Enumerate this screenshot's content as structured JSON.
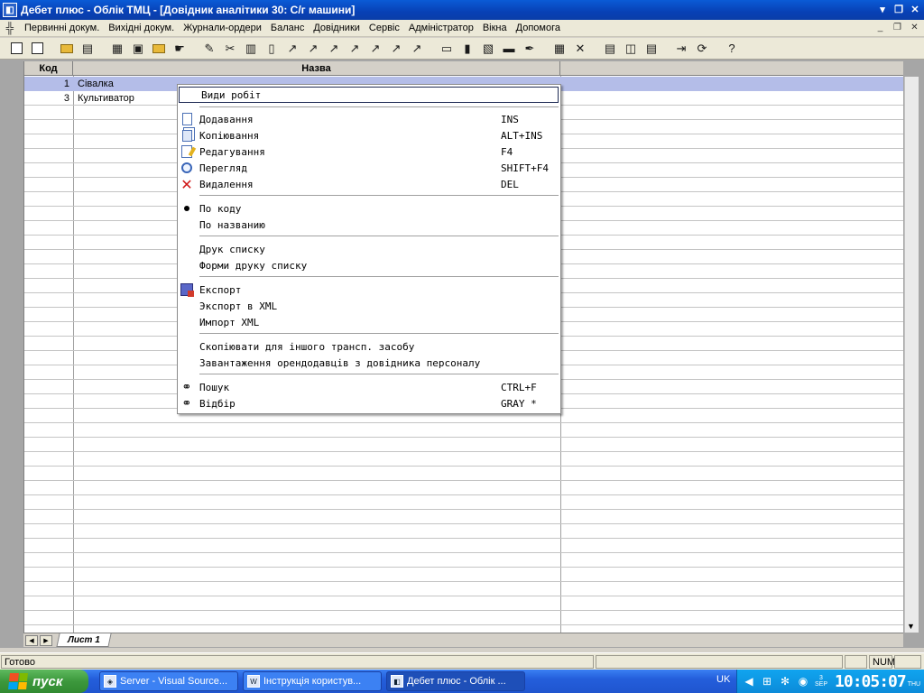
{
  "window": {
    "title": "Дебет плюс - Облік ТМЦ - [Довідник аналітики 30: С/г машини]"
  },
  "menubar": {
    "items": [
      "Первинні докум.",
      "Вихідні докум.",
      "Журнали-ордери",
      "Баланс",
      "Довідники",
      "Сервіс",
      "Адміністратор",
      "Вікна",
      "Допомога"
    ]
  },
  "grid": {
    "columns": [
      "Код",
      "Назва"
    ],
    "rows": [
      {
        "code": "1",
        "name": "Сівалка"
      },
      {
        "code": "3",
        "name": "Культиватор"
      }
    ]
  },
  "sheet_tab": "Лист 1",
  "context_menu": {
    "header": "Види робіт",
    "items": [
      {
        "label": "Додавання",
        "shortcut": "INS"
      },
      {
        "label": "Копіювання",
        "shortcut": "ALT+INS"
      },
      {
        "label": "Редагування",
        "shortcut": "F4"
      },
      {
        "label": "Перегляд",
        "shortcut": "SHIFT+F4"
      },
      {
        "label": "Видалення",
        "shortcut": "DEL"
      },
      {
        "label": "По коду"
      },
      {
        "label": "По названию"
      },
      {
        "label": "Друк списку"
      },
      {
        "label": "Форми друку списку"
      },
      {
        "label": "Експорт"
      },
      {
        "label": "Экспорт в XML"
      },
      {
        "label": "Импорт XML"
      },
      {
        "label": "Скопіювати для іншого трансп. засобу"
      },
      {
        "label": "Завантаження орендодавців з довідника персоналу"
      },
      {
        "label": "Пошук",
        "shortcut": "CTRL+F"
      },
      {
        "label": "Відбір",
        "shortcut": "GRAY *"
      }
    ]
  },
  "statusbar": {
    "text": "Готово",
    "num": "NUM"
  },
  "taskbar": {
    "start": "пуск",
    "tasks": [
      "Server - Visual Source...",
      "Інструкція користув...",
      "Дебет плюс - Облік ..."
    ],
    "lang": "UK",
    "date_day": "3",
    "date_month": "SEP",
    "clock": "10:05:07",
    "weekday": "THU"
  }
}
